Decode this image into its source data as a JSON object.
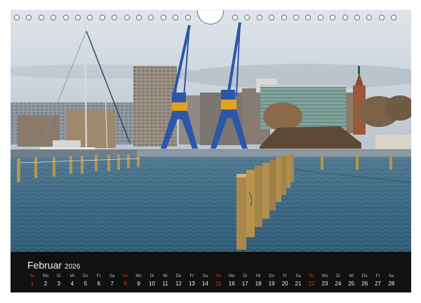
{
  "photo": {
    "subject": "harbour-with-cranes",
    "colors": {
      "sky": "#c9d3dc",
      "water": "#3f6b86",
      "crane": "#2c57a8",
      "post": "#b8944c"
    }
  },
  "calendar": {
    "month": "Februar",
    "year": "2026",
    "days": [
      {
        "dow": "So",
        "date": "1",
        "sunday": true
      },
      {
        "dow": "Mo",
        "date": "2",
        "sunday": false
      },
      {
        "dow": "Di",
        "date": "3",
        "sunday": false
      },
      {
        "dow": "Mi",
        "date": "4",
        "sunday": false
      },
      {
        "dow": "Do",
        "date": "5",
        "sunday": false
      },
      {
        "dow": "Fr",
        "date": "6",
        "sunday": false
      },
      {
        "dow": "Sa",
        "date": "7",
        "sunday": false
      },
      {
        "dow": "So",
        "date": "8",
        "sunday": true
      },
      {
        "dow": "Mo",
        "date": "9",
        "sunday": false
      },
      {
        "dow": "Di",
        "date": "10",
        "sunday": false
      },
      {
        "dow": "Mi",
        "date": "11",
        "sunday": false
      },
      {
        "dow": "Do",
        "date": "12",
        "sunday": false
      },
      {
        "dow": "Fr",
        "date": "13",
        "sunday": false
      },
      {
        "dow": "Sa",
        "date": "14",
        "sunday": false
      },
      {
        "dow": "So",
        "date": "15",
        "sunday": true
      },
      {
        "dow": "Mo",
        "date": "16",
        "sunday": false
      },
      {
        "dow": "Di",
        "date": "17",
        "sunday": false
      },
      {
        "dow": "Mi",
        "date": "18",
        "sunday": false
      },
      {
        "dow": "Do",
        "date": "19",
        "sunday": false
      },
      {
        "dow": "Fr",
        "date": "20",
        "sunday": false
      },
      {
        "dow": "Sa",
        "date": "21",
        "sunday": false
      },
      {
        "dow": "So",
        "date": "22",
        "sunday": true
      },
      {
        "dow": "Mo",
        "date": "23",
        "sunday": false
      },
      {
        "dow": "Di",
        "date": "24",
        "sunday": false
      },
      {
        "dow": "Mi",
        "date": "25",
        "sunday": false
      },
      {
        "dow": "Do",
        "date": "26",
        "sunday": false
      },
      {
        "dow": "Fr",
        "date": "27",
        "sunday": false
      },
      {
        "dow": "Sa",
        "date": "28",
        "sunday": false
      }
    ],
    "colors": {
      "background": "#111111",
      "sunday": "#e0301e",
      "text": "#f0f0f0"
    }
  }
}
